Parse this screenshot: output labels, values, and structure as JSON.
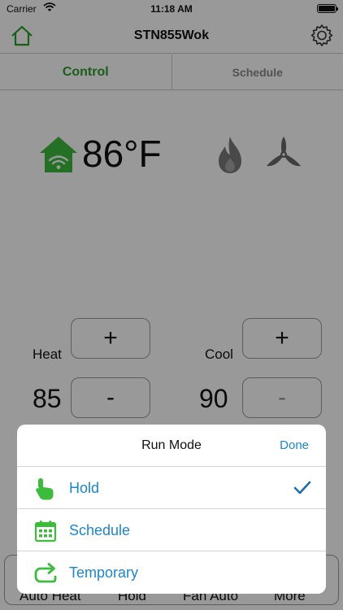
{
  "status_bar": {
    "carrier": "Carrier",
    "time": "11:18 AM"
  },
  "nav": {
    "title": "STN855Wok"
  },
  "tabs": [
    {
      "label": "Control",
      "active": true
    },
    {
      "label": "Schedule",
      "active": false
    }
  ],
  "current_temp": "86°F",
  "heat": {
    "label": "Heat",
    "value": "85",
    "plus": "+",
    "minus": "-"
  },
  "cool": {
    "label": "Cool",
    "value": "90",
    "plus": "+",
    "minus": "-"
  },
  "bottom_bar": [
    "Auto Heat",
    "Hold",
    "Fan Auto",
    "More"
  ],
  "sheet": {
    "title": "Run Mode",
    "done_label": "Done",
    "options": [
      {
        "label": "Hold",
        "icon": "hand-pointer-icon",
        "selected": true
      },
      {
        "label": "Schedule",
        "icon": "calendar-icon",
        "selected": false
      },
      {
        "label": "Temporary",
        "icon": "redo-arrow-icon",
        "selected": false
      }
    ]
  },
  "colors": {
    "accent_green": "#2a9e2a",
    "icon_green": "#3dbb3d",
    "link_blue": "#1d86c8"
  }
}
